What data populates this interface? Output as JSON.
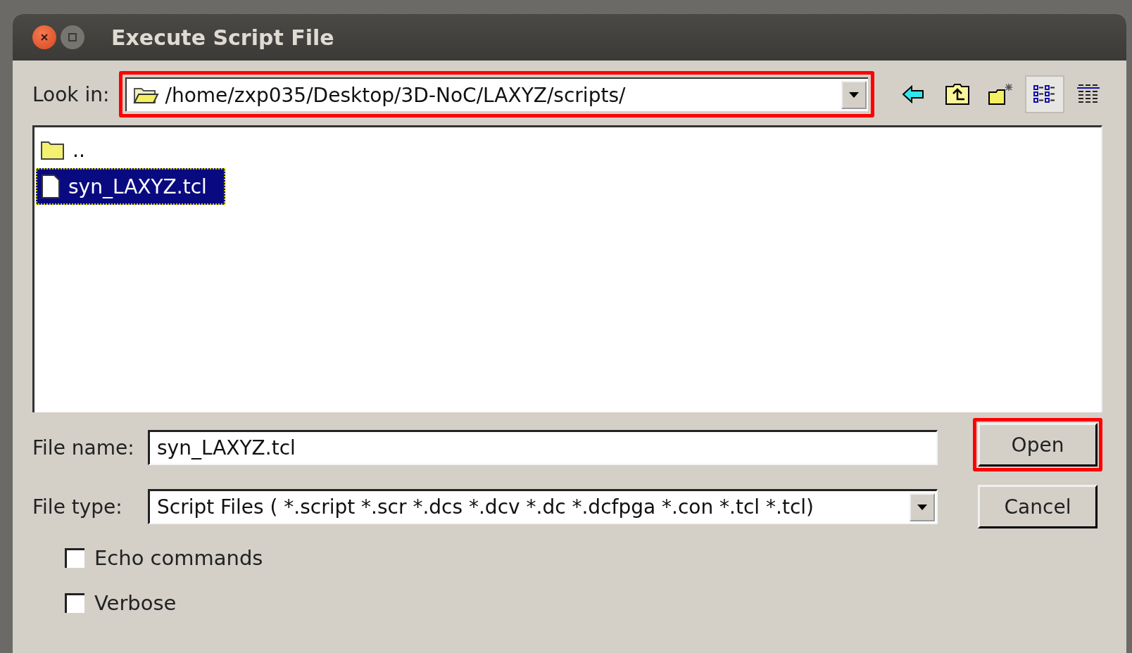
{
  "window": {
    "title": "Execute Script File"
  },
  "look_in": {
    "label": "Look in:",
    "value": "/home/zxp035/Desktop/3D-NoC/LAXYZ/scripts/",
    "highlighted": true
  },
  "view_modes": [
    {
      "kind": "list",
      "selected": true
    },
    {
      "kind": "details",
      "selected": false
    }
  ],
  "files": [
    {
      "kind": "folder",
      "name": "..",
      "selected": false
    },
    {
      "kind": "file",
      "name": "syn_LAXYZ.tcl",
      "selected": true
    }
  ],
  "file_name": {
    "label": "File name:",
    "value": "syn_LAXYZ.tcl"
  },
  "file_type": {
    "label": "File type:",
    "value": "Script Files ( *.script *.scr *.dcs *.dcv *.dc *.dcfpga *.con *.tcl *.tcl)"
  },
  "buttons": [
    {
      "label": "Open",
      "highlighted": true
    },
    {
      "label": "Cancel",
      "highlighted": false
    }
  ],
  "options": [
    {
      "label": "Echo commands",
      "checked": false
    },
    {
      "label": "Verbose",
      "checked": false
    }
  ]
}
